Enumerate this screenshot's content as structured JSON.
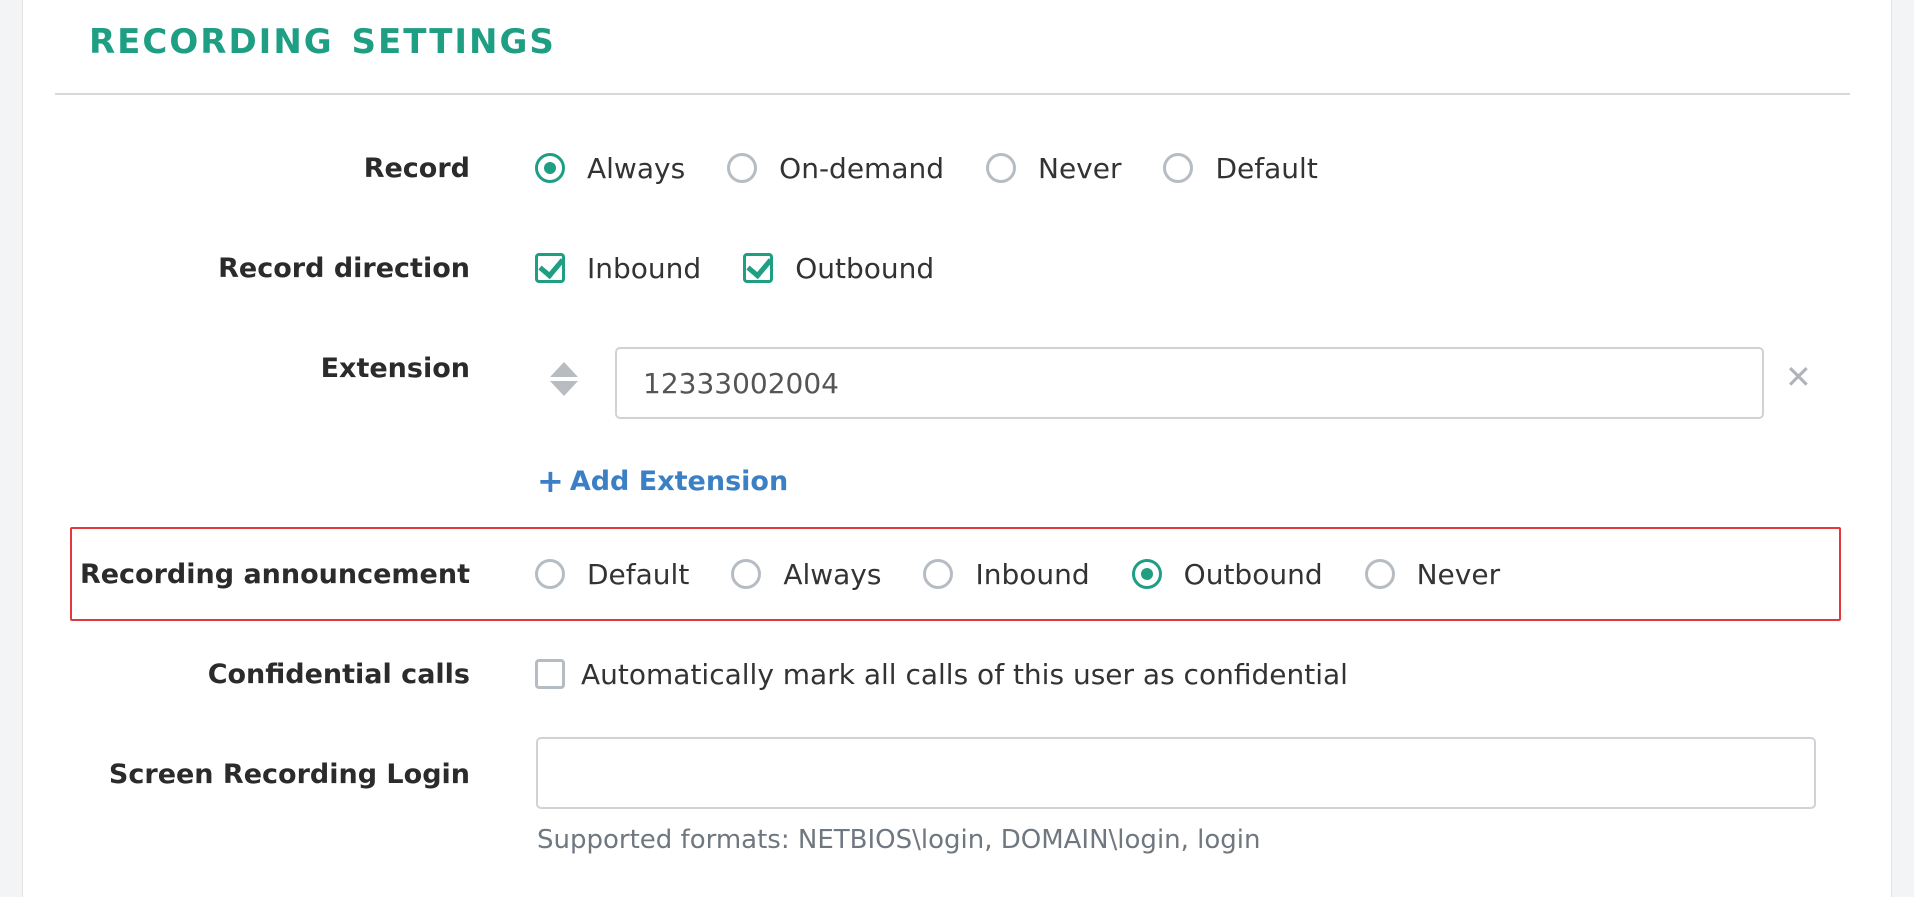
{
  "section": {
    "title": "RECORDING SETTINGS"
  },
  "record": {
    "label": "Record",
    "options": [
      "Always",
      "On-demand",
      "Never",
      "Default"
    ],
    "selected": "Always"
  },
  "record_direction": {
    "label": "Record direction",
    "options": [
      "Inbound",
      "Outbound"
    ],
    "checked": [
      "Inbound",
      "Outbound"
    ]
  },
  "extension": {
    "label": "Extension",
    "value": "12333002004",
    "remove_icon": "close-icon",
    "add_label": "Add Extension"
  },
  "recording_announcement": {
    "label": "Recording announcement",
    "options": [
      "Default",
      "Always",
      "Inbound",
      "Outbound",
      "Never"
    ],
    "selected": "Outbound"
  },
  "confidential_calls": {
    "label": "Confidential calls",
    "checkbox_label": "Automatically mark all calls of this user as confidential",
    "checked": false
  },
  "screen_recording_login": {
    "label": "Screen Recording Login",
    "value": "",
    "hint": "Supported formats: NETBIOS\\login, DOMAIN\\login, login"
  },
  "colors": {
    "accent": "#1e9e82",
    "link": "#3b7fc4",
    "highlight": "#e0393e"
  }
}
